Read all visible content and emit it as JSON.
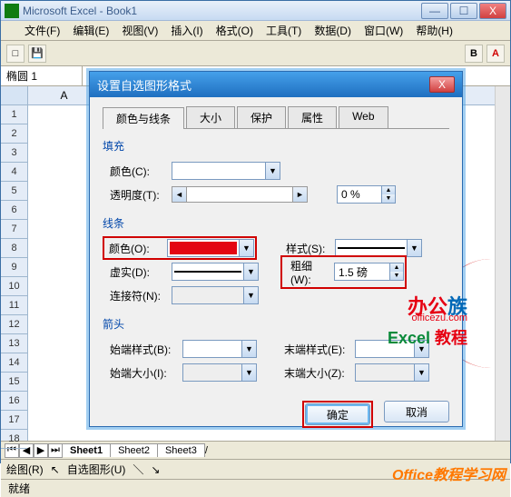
{
  "window": {
    "title": "Microsoft Excel - Book1",
    "min": "—",
    "max": "☐",
    "close": "X"
  },
  "menu": {
    "file": "文件(F)",
    "edit": "编辑(E)",
    "view": "视图(V)",
    "insert": "插入(I)",
    "format": "格式(O)",
    "tools": "工具(T)",
    "data": "数据(D)",
    "window_m": "窗口(W)",
    "help": "帮助(H)"
  },
  "namebox": "椭圆 1",
  "col_a": "A",
  "rows": [
    "1",
    "2",
    "3",
    "4",
    "5",
    "6",
    "7",
    "8",
    "9",
    "10",
    "11",
    "12",
    "13",
    "14",
    "15",
    "16",
    "17",
    "18"
  ],
  "sheet_tabs": {
    "s1": "Sheet1",
    "s2": "Sheet2",
    "s3": "Sheet3"
  },
  "drawbar": {
    "draw": "绘图(R)",
    "autoshape": "自选图形(U)"
  },
  "status": "就绪",
  "dialog": {
    "title": "设置自选图形格式",
    "close": "X",
    "tabs": {
      "t1": "颜色与线条",
      "t2": "大小",
      "t3": "保护",
      "t4": "属性",
      "t5": "Web"
    },
    "fill_group": "填充",
    "fill_color_label": "颜色(C):",
    "transparency_label": "透明度(T):",
    "transparency_value": "0 %",
    "slider_left": "◄",
    "slider_right": "►",
    "line_group": "线条",
    "line_color_label": "颜色(O):",
    "line_style_label": "样式(S):",
    "dash_label": "虚实(D):",
    "weight_label": "粗细(W):",
    "weight_value": "1.5 磅",
    "connector_label": "连接符(N):",
    "arrow_group": "箭头",
    "begin_style_label": "始端样式(B):",
    "end_style_label": "末端样式(E):",
    "begin_size_label": "始端大小(I):",
    "end_size_label": "末端大小(Z):",
    "ok": "确定",
    "cancel": "取消",
    "dropdown_arrow": "▼",
    "spin_up": "▲",
    "spin_down": "▼"
  },
  "watermark": {
    "brand_a": "办公",
    "brand_b": "族",
    "url": "officezu.com",
    "excel_a": "Excel",
    "excel_b": "教程",
    "site": "Office教程学习网"
  }
}
